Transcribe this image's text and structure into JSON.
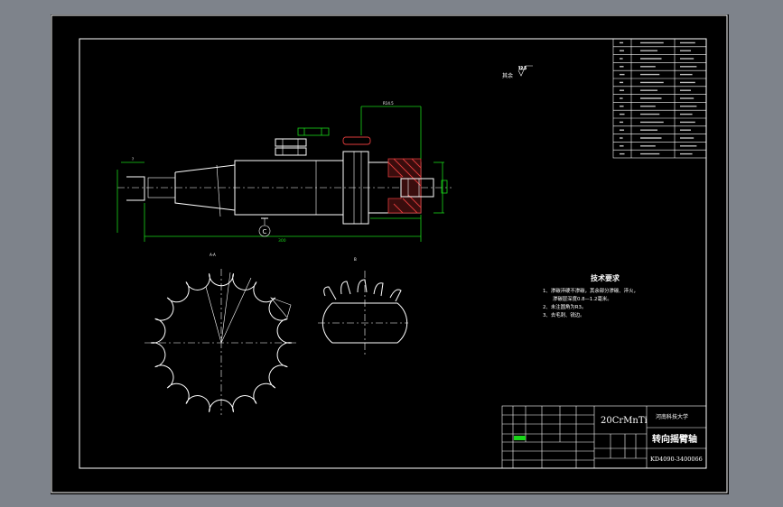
{
  "material": "20CrMnTi",
  "part_name": "转向摇臂轴",
  "drawing_number": "KD4090-3400066",
  "university": "河南科技大学",
  "tech_req": {
    "title": "技术要求",
    "lines": [
      "1、渗碳淬硬不渗碳，其余部分渗碳、淬火，",
      "渗碳层深度0.8—1.2毫米。",
      "2、未注圆角为R3。",
      "3、去毛刺、锐边。"
    ]
  },
  "roughness_note": "其余",
  "datum_label": "C",
  "section_label": "A-A",
  "view_label": "B",
  "total_length_dim": "300",
  "colors": {
    "background": "#7e838b",
    "paper": "#000000",
    "line": "#ffffff",
    "dim": "#19d619",
    "hatch": "#e03c3c"
  }
}
